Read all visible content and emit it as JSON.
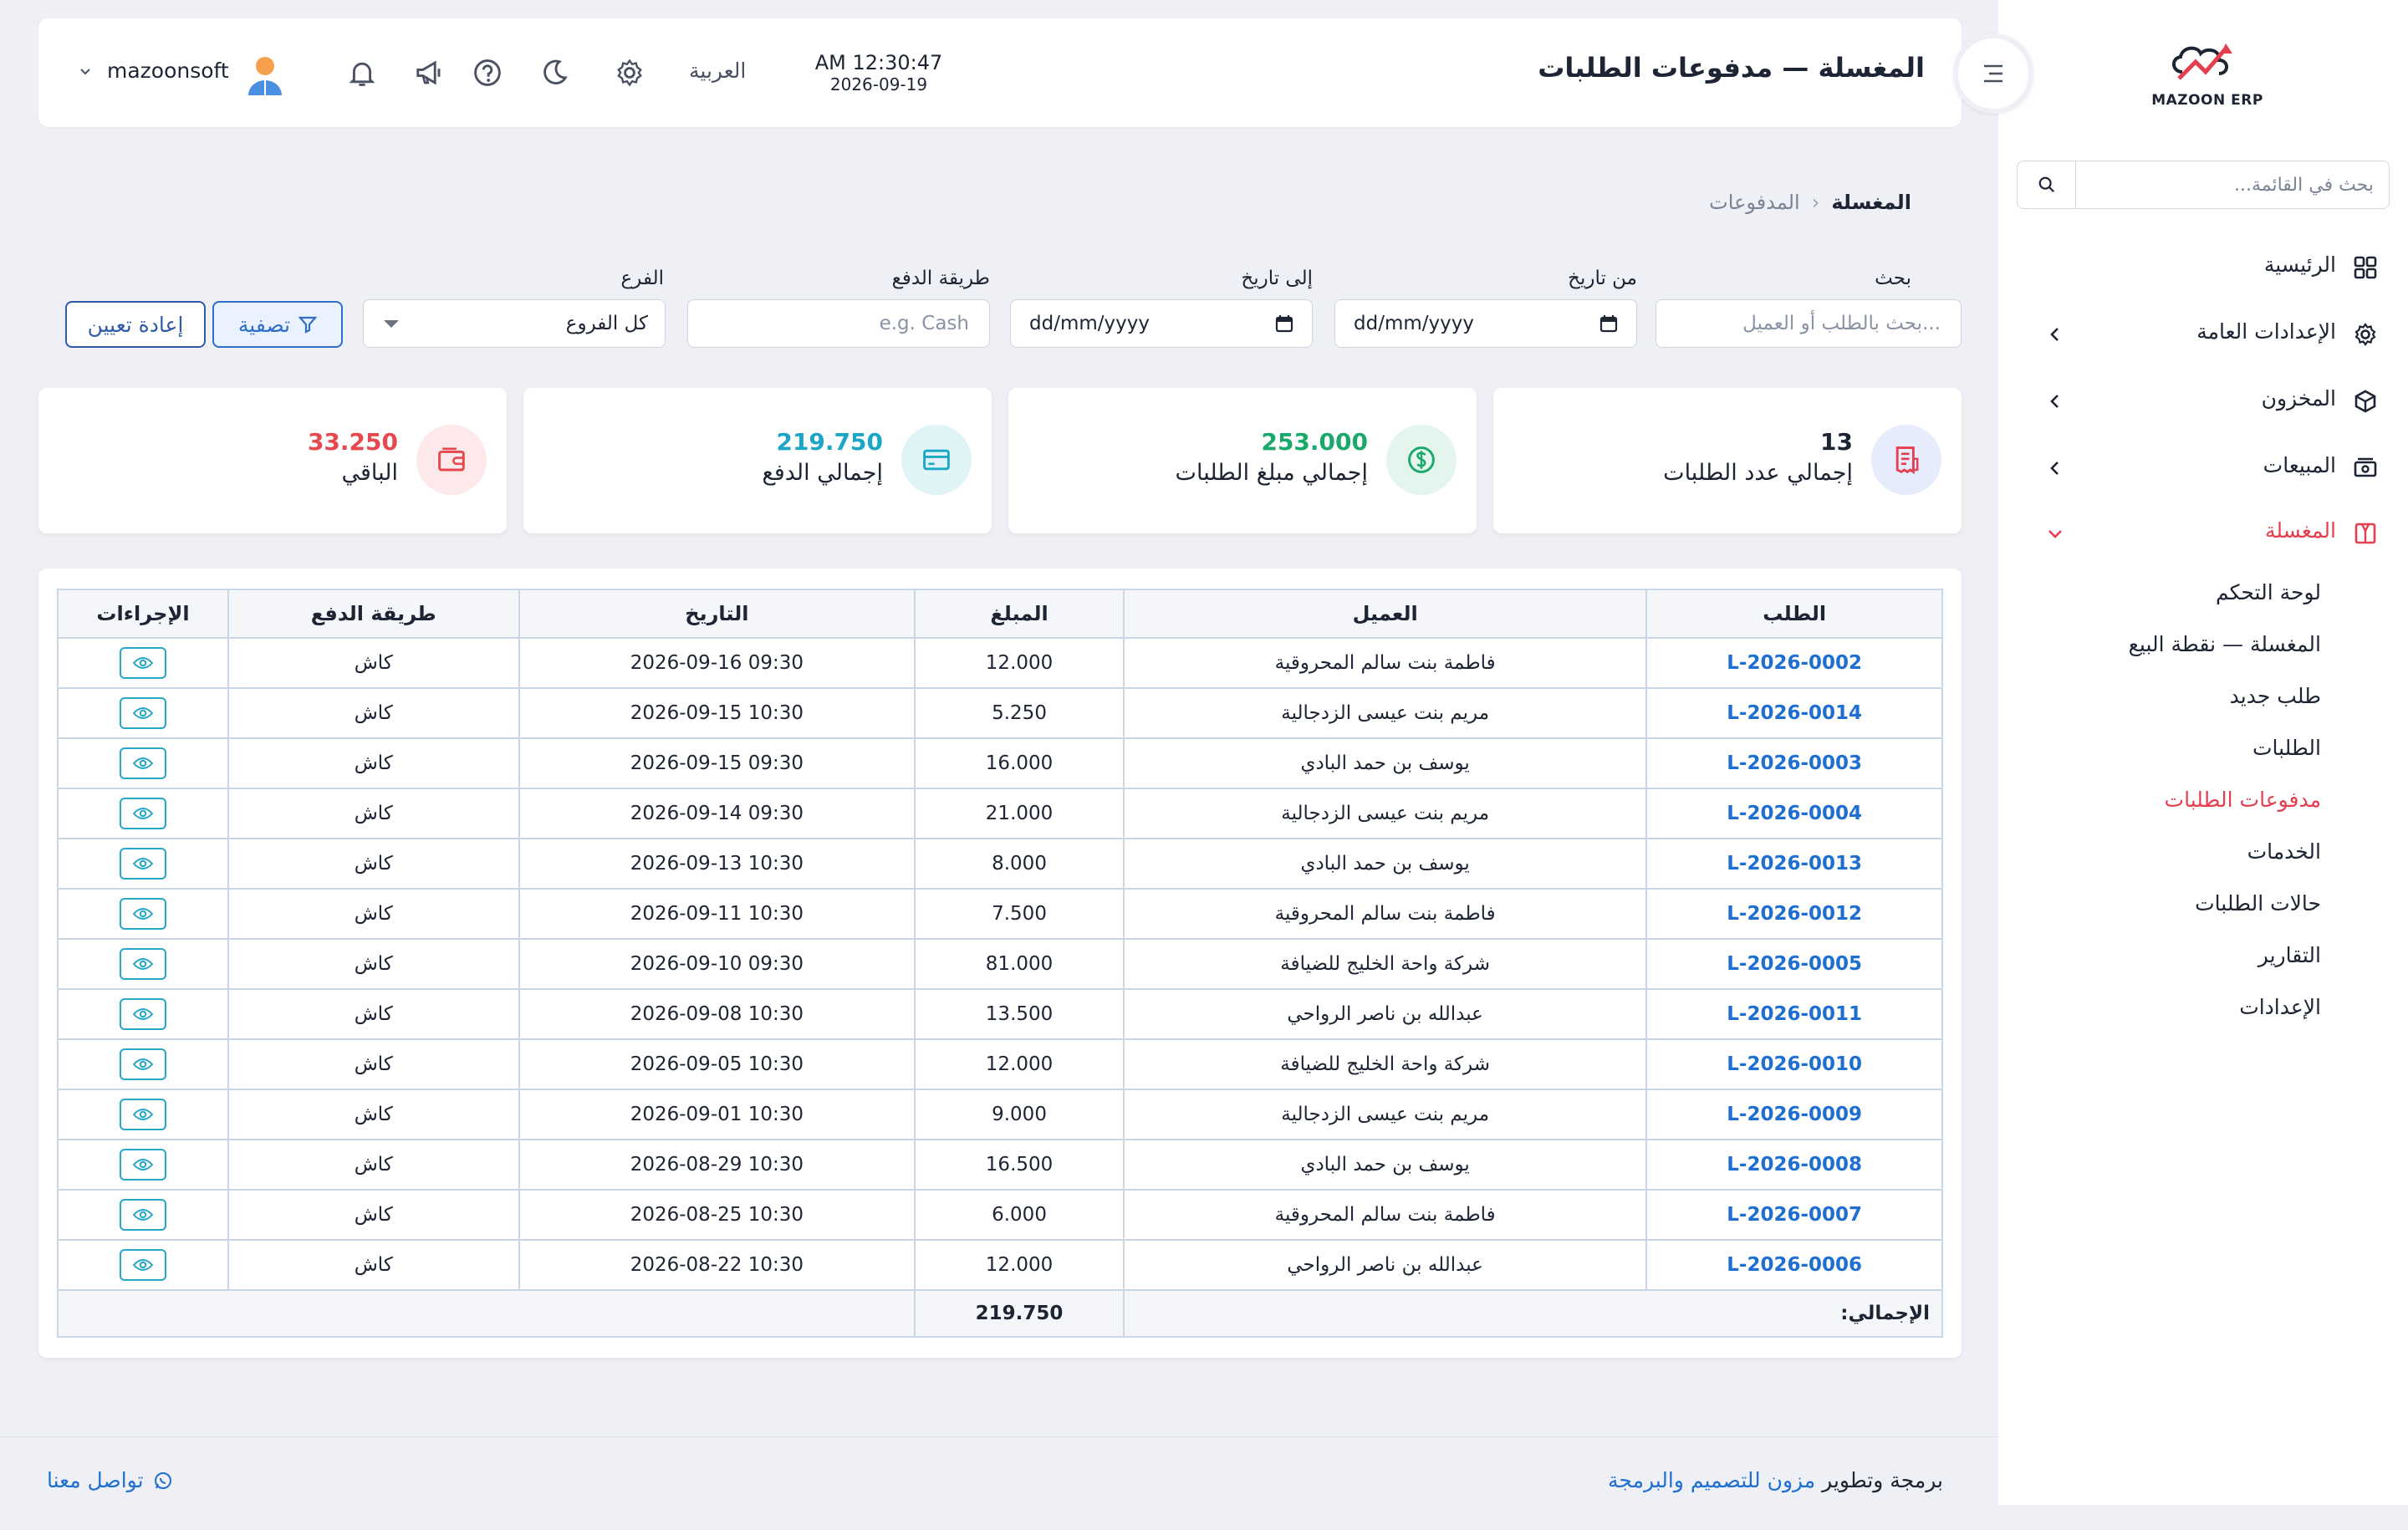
{
  "sidebar": {
    "brand": "MAZOON ERP",
    "search_placeholder": "بحث في القائمة...",
    "items": [
      {
        "label": "الرئيسية",
        "icon": "grid-icon"
      },
      {
        "label": "الإعدادات العامة",
        "icon": "gear-icon"
      },
      {
        "label": "المخزون",
        "icon": "box-icon"
      },
      {
        "label": "المبيعات",
        "icon": "cash-icon"
      },
      {
        "label": "المغسلة",
        "icon": "laundry-icon"
      }
    ],
    "submenu": [
      {
        "label": "لوحة التحكم"
      },
      {
        "label": "المغسلة — نقطة البيع"
      },
      {
        "label": "طلب جديد"
      },
      {
        "label": "الطلبات"
      },
      {
        "label": "مدفوعات الطلبات"
      },
      {
        "label": "الخدمات"
      },
      {
        "label": "حالات الطلبات"
      },
      {
        "label": "التقارير"
      },
      {
        "label": "الإعدادات"
      }
    ]
  },
  "header": {
    "title": "المغسلة — مدفوعات الطلبات",
    "time": "AM 12:30:47",
    "date": "2026-09-19",
    "language": "العربية",
    "username": "mazoonsoft"
  },
  "breadcrumb": {
    "root": "المغسلة",
    "current": "المدفوعات"
  },
  "filters": {
    "search_label": "بحث",
    "search_placeholder": "بحث بالطلب أو العميل...",
    "from_label": "من تاريخ",
    "to_label": "إلى تاريخ",
    "date_placeholder": "dd/mm/yyyy",
    "method_label": "طريقة الدفع",
    "method_placeholder": "e.g. Cash",
    "branch_label": "الفرع",
    "branch_value": "كل الفروع",
    "filter_button": "تصفية",
    "reset_button": "إعادة تعيين"
  },
  "stats": [
    {
      "value": "13",
      "label": "إجمالي عدد الطلبات",
      "color": "#1d2433",
      "icon": "receipt-icon"
    },
    {
      "value": "253.000",
      "label": "إجمالي مبلغ الطلبات",
      "color": "#1aa86b",
      "icon": "dollar-icon"
    },
    {
      "value": "219.750",
      "label": "إجمالي الدفع",
      "color": "#1ba6c5",
      "icon": "card-icon"
    },
    {
      "value": "33.250",
      "label": "الباقي",
      "color": "#e5484d",
      "icon": "wallet-icon"
    }
  ],
  "table": {
    "headers": {
      "order": "الطلب",
      "customer": "العميل",
      "amount": "المبلغ",
      "date": "التاريخ",
      "method": "طريقة الدفع",
      "actions": "الإجراءات"
    },
    "rows": [
      {
        "order": "L-2026-0002",
        "customer": "فاطمة بنت سالم المحروقية",
        "amount": "12.000",
        "date": "09:30 2026-09-16",
        "method": "كاش"
      },
      {
        "order": "L-2026-0014",
        "customer": "مريم بنت عيسى الزدجالية",
        "amount": "5.250",
        "date": "10:30 2026-09-15",
        "method": "كاش"
      },
      {
        "order": "L-2026-0003",
        "customer": "يوسف بن حمد البادي",
        "amount": "16.000",
        "date": "09:30 2026-09-15",
        "method": "كاش"
      },
      {
        "order": "L-2026-0004",
        "customer": "مريم بنت عيسى الزدجالية",
        "amount": "21.000",
        "date": "09:30 2026-09-14",
        "method": "كاش"
      },
      {
        "order": "L-2026-0013",
        "customer": "يوسف بن حمد البادي",
        "amount": "8.000",
        "date": "10:30 2026-09-13",
        "method": "كاش"
      },
      {
        "order": "L-2026-0012",
        "customer": "فاطمة بنت سالم المحروقية",
        "amount": "7.500",
        "date": "10:30 2026-09-11",
        "method": "كاش"
      },
      {
        "order": "L-2026-0005",
        "customer": "شركة واحة الخليج للضيافة",
        "amount": "81.000",
        "date": "09:30 2026-09-10",
        "method": "كاش"
      },
      {
        "order": "L-2026-0011",
        "customer": "عبدالله بن ناصر الرواحي",
        "amount": "13.500",
        "date": "10:30 2026-09-08",
        "method": "كاش"
      },
      {
        "order": "L-2026-0010",
        "customer": "شركة واحة الخليج للضيافة",
        "amount": "12.000",
        "date": "10:30 2026-09-05",
        "method": "كاش"
      },
      {
        "order": "L-2026-0009",
        "customer": "مريم بنت عيسى الزدجالية",
        "amount": "9.000",
        "date": "10:30 2026-09-01",
        "method": "كاش"
      },
      {
        "order": "L-2026-0008",
        "customer": "يوسف بن حمد البادي",
        "amount": "16.500",
        "date": "10:30 2026-08-29",
        "method": "كاش"
      },
      {
        "order": "L-2026-0007",
        "customer": "فاطمة بنت سالم المحروقية",
        "amount": "6.000",
        "date": "10:30 2026-08-25",
        "method": "كاش"
      },
      {
        "order": "L-2026-0006",
        "customer": "عبدالله بن ناصر الرواحي",
        "amount": "12.000",
        "date": "10:30 2026-08-22",
        "method": "كاش"
      }
    ],
    "total_label": "الإجمالي:",
    "total_value": "219.750"
  },
  "footer": {
    "credit_prefix": "برمجة وتطوير",
    "credit_link": "مزون للتصميم والبرمجة",
    "contact": "تواصل معنا"
  },
  "colors": {
    "accent": "#e53e4f",
    "link": "#1e6fd1",
    "primary": "#2f6ec9"
  }
}
